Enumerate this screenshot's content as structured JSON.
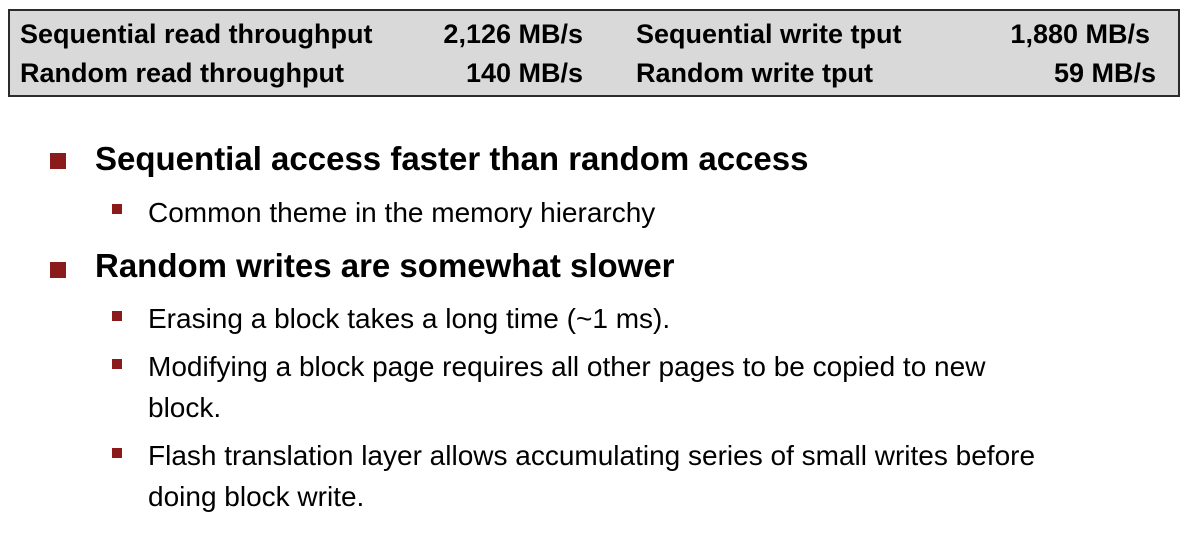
{
  "stats": {
    "rows": [
      {
        "left_label": "Sequential read throughput",
        "left_value": "2,126 MB/s",
        "right_label": "Sequential write tput",
        "right_value": "1,880 MB/s"
      },
      {
        "left_label": "Random read throughput",
        "left_value": "140 MB/s",
        "right_label": "Random write tput",
        "right_value": "59 MB/s"
      }
    ]
  },
  "bullets": [
    {
      "text": "Sequential access faster than random access",
      "sub": [
        "Common theme in the memory hierarchy"
      ]
    },
    {
      "text": "Random writes are somewhat slower",
      "sub": [
        "Erasing a block takes a long time (~1 ms).",
        "Modifying a block page requires all other pages to be copied to new block.",
        "Flash translation layer allows accumulating series of small writes before doing block write."
      ]
    }
  ],
  "colors": {
    "table_bg": "#d9d9d9",
    "bullet_marker": "#8b1a1a"
  }
}
